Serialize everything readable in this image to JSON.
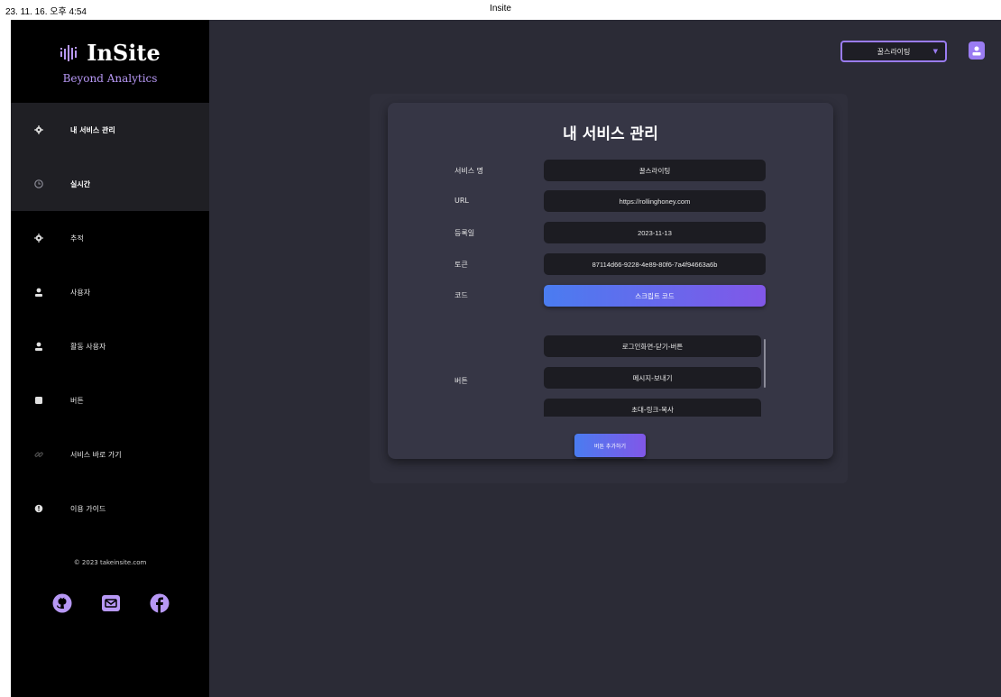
{
  "print_header": {
    "datetime": "23. 11. 16. 오후 4:54",
    "title": "Insite"
  },
  "sidebar": {
    "brand": "InSite",
    "tagline": "Beyond Analytics",
    "items": [
      {
        "label": "내 서비스 관리",
        "icon": "gear-icon",
        "active": true
      },
      {
        "label": "실시간",
        "icon": "clock-icon",
        "active": true
      },
      {
        "label": "추적",
        "icon": "crosshair-icon",
        "active": false
      },
      {
        "label": "사용자",
        "icon": "user-icon",
        "active": false
      },
      {
        "label": "활동 사용자",
        "icon": "active-user-icon",
        "active": false
      },
      {
        "label": "버튼",
        "icon": "square-button-icon",
        "active": false
      },
      {
        "label": "서비스 바로 가기",
        "icon": "link-icon",
        "active": false
      },
      {
        "label": "이용 가이드",
        "icon": "info-icon",
        "active": false
      }
    ],
    "copyright": "© 2023 takeinsite.com",
    "social": [
      "github-icon",
      "mail-icon",
      "facebook-icon"
    ]
  },
  "topbar": {
    "service_select": "꿀스라이팅"
  },
  "card": {
    "title": "내 서비스 관리",
    "fields": {
      "service_name_label": "서비스 명",
      "service_name": "꿀스라이팅",
      "url_label": "URL",
      "url": "https://rollinghoney.com",
      "registered_label": "등록일",
      "registered": "2023-11-13",
      "token_label": "토큰",
      "token": "87114d66-9228-4e89-80f6-7a4f94663a6b",
      "code_label": "코드",
      "code_button": "스크립트 코드",
      "buttons_label": "버튼"
    },
    "buttons": [
      "로그인화면-닫기-버튼",
      "메시지-보내기",
      "초대-링크-복사"
    ],
    "add_button": "버튼 추가하기"
  },
  "colors": {
    "accent": "#9a7cf2",
    "gradient_start": "#4a7cf0",
    "gradient_end": "#8157e8",
    "sidebar_bg": "#000000",
    "main_bg": "#2b2b36",
    "card_bg": "#363645",
    "field_bg": "#1c1c22"
  }
}
